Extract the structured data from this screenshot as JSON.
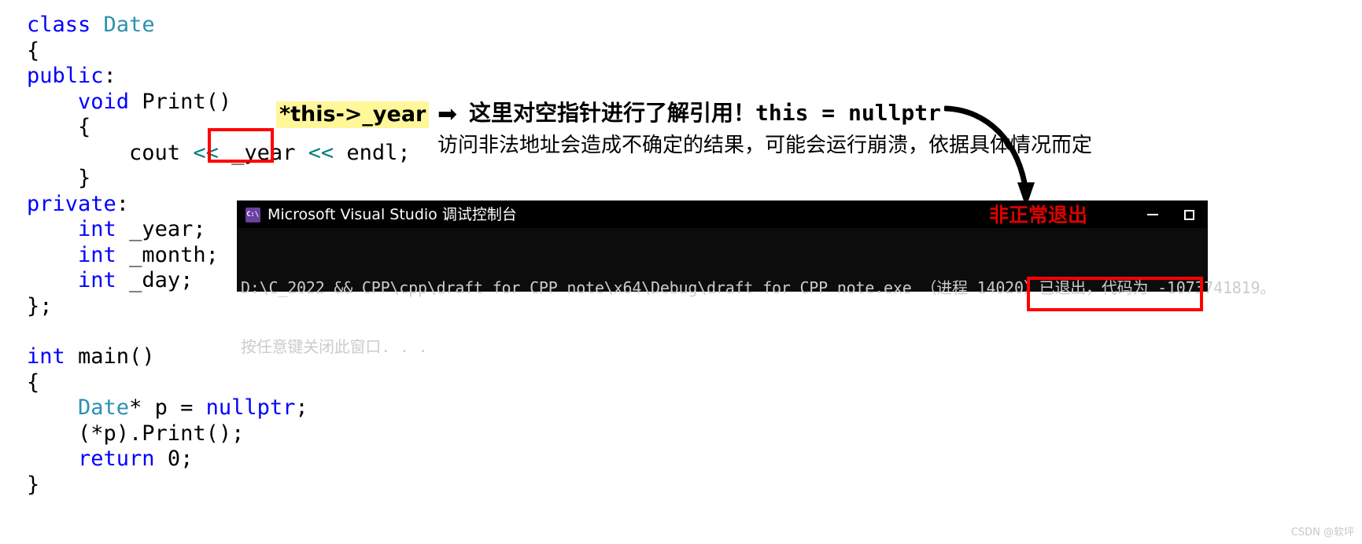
{
  "code_top": {
    "lines": [
      [
        {
          "t": "class ",
          "c": "kw"
        },
        {
          "t": "Date",
          "c": "type"
        }
      ],
      [
        {
          "t": "{",
          "c": "plain"
        }
      ],
      [
        {
          "t": "public",
          "c": "kw"
        },
        {
          "t": ":",
          "c": "plain"
        }
      ],
      [
        {
          "t": "    ",
          "c": "plain"
        },
        {
          "t": "void",
          "c": "kw"
        },
        {
          "t": " Print()",
          "c": "plain"
        }
      ],
      [
        {
          "t": "    {",
          "c": "plain"
        }
      ],
      [
        {
          "t": "        cout ",
          "c": "plain"
        },
        {
          "t": "<<",
          "c": "op"
        },
        {
          "t": " _year ",
          "c": "plain"
        },
        {
          "t": "<<",
          "c": "op"
        },
        {
          "t": " endl;",
          "c": "plain"
        }
      ],
      [
        {
          "t": "    }",
          "c": "plain"
        }
      ],
      [
        {
          "t": "private",
          "c": "kw"
        },
        {
          "t": ":",
          "c": "plain"
        }
      ],
      [
        {
          "t": "    ",
          "c": "plain"
        },
        {
          "t": "int",
          "c": "kw"
        },
        {
          "t": " _year;",
          "c": "plain"
        }
      ],
      [
        {
          "t": "    ",
          "c": "plain"
        },
        {
          "t": "int",
          "c": "kw"
        },
        {
          "t": " _month;",
          "c": "plain"
        }
      ],
      [
        {
          "t": "    ",
          "c": "plain"
        },
        {
          "t": "int",
          "c": "kw"
        },
        {
          "t": " _day;",
          "c": "plain"
        }
      ],
      [
        {
          "t": "};",
          "c": "plain"
        }
      ]
    ]
  },
  "code_bottom": {
    "lines": [
      [
        {
          "t": "int",
          "c": "kw"
        },
        {
          "t": " main()",
          "c": "plain"
        }
      ],
      [
        {
          "t": "{",
          "c": "plain"
        }
      ],
      [
        {
          "t": "    ",
          "c": "plain"
        },
        {
          "t": "Date",
          "c": "type"
        },
        {
          "t": "* p = ",
          "c": "plain"
        },
        {
          "t": "nullptr",
          "c": "kw"
        },
        {
          "t": ";",
          "c": "plain"
        }
      ],
      [
        {
          "t": "    (*p).Print();",
          "c": "plain"
        }
      ],
      [
        {
          "t": "    ",
          "c": "plain"
        },
        {
          "t": "return",
          "c": "kw"
        },
        {
          "t": " 0;",
          "c": "plain"
        }
      ],
      [
        {
          "t": "}",
          "c": "plain"
        }
      ]
    ]
  },
  "annotations": {
    "highlighted_expression": "*this->_year",
    "arrow_glyph": "➡",
    "line1": "这里对空指针进行了解引用！this = nullptr",
    "line2": "访问非法地址会造成不确定的结果，可能会运行崩溃，依据具体情况而定",
    "boxed_identifier": "_year"
  },
  "console": {
    "title": "Microsoft Visual Studio 调试控制台",
    "icon_label": "C:\\",
    "exit_note": "非正常退出",
    "minimize_label": "最小化",
    "maximize_label": "最大化",
    "line1": "D:\\C_2022 && CPP\\cpp\\draft for CPP note\\x64\\Debug\\draft for CPP note.exe （进程 14020）已退出，代码为 -1073741819。",
    "line2": "按任意键关闭此窗口. . .",
    "exit_code": "-1073741819",
    "process_id": "14020",
    "highlight_color": "#ff0000"
  },
  "watermark": "CSDN @软坪"
}
